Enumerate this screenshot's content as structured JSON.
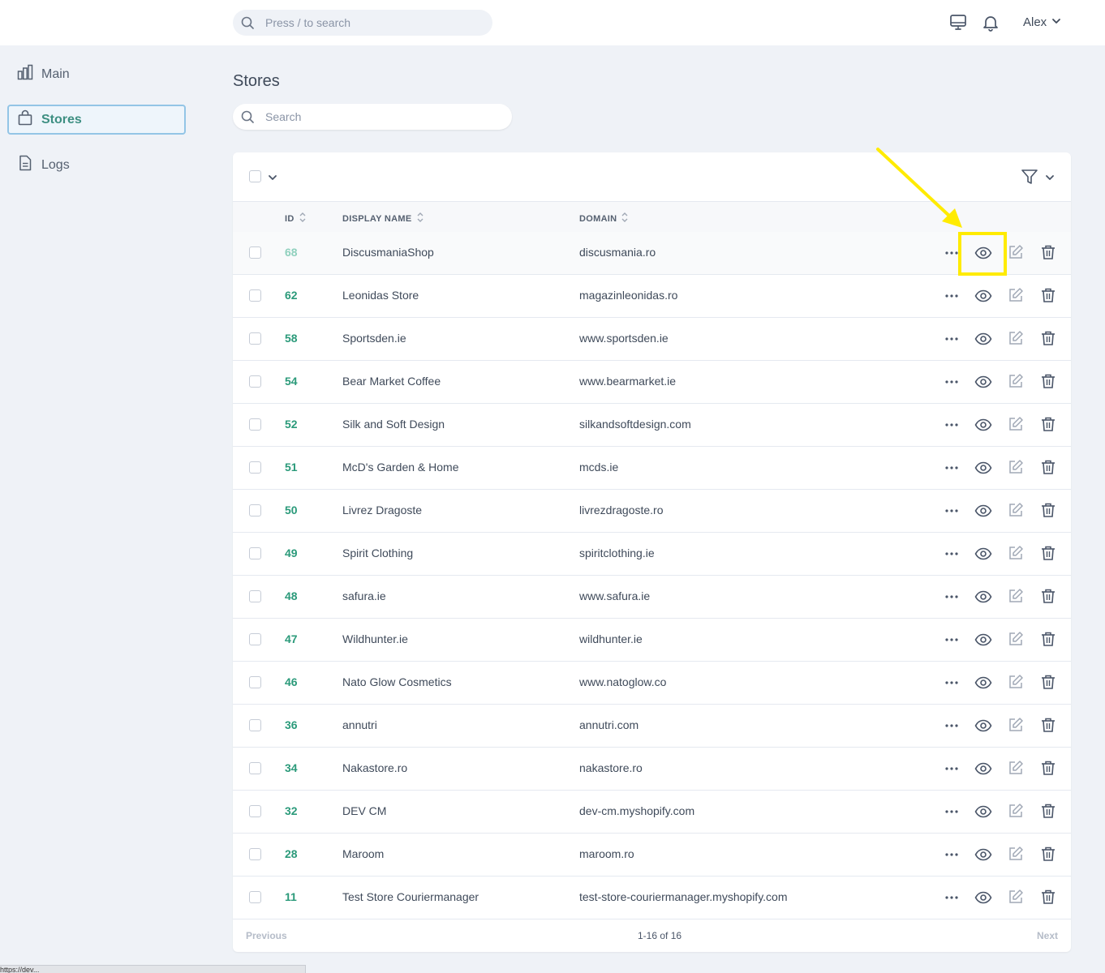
{
  "topbar": {
    "search_placeholder": "Press / to search",
    "user_name": "Alex"
  },
  "sidebar": {
    "items": [
      {
        "label": "Main"
      },
      {
        "label": "Stores"
      },
      {
        "label": "Logs"
      }
    ]
  },
  "page": {
    "title": "Stores",
    "search_placeholder": "Search"
  },
  "table": {
    "columns": {
      "id": "ID",
      "name": "DISPLAY NAME",
      "domain": "DOMAIN"
    },
    "rows": [
      {
        "id": "68",
        "name": "DiscusmaniaShop",
        "domain": "discusmania.ro"
      },
      {
        "id": "62",
        "name": "Leonidas Store",
        "domain": "magazinleonidas.ro"
      },
      {
        "id": "58",
        "name": "Sportsden.ie",
        "domain": "www.sportsden.ie"
      },
      {
        "id": "54",
        "name": "Bear Market Coffee",
        "domain": "www.bearmarket.ie"
      },
      {
        "id": "52",
        "name": "Silk and Soft Design",
        "domain": "silkandsoftdesign.com"
      },
      {
        "id": "51",
        "name": "McD's Garden & Home",
        "domain": "mcds.ie"
      },
      {
        "id": "50",
        "name": "Livrez Dragoste",
        "domain": "livrezdragoste.ro"
      },
      {
        "id": "49",
        "name": "Spirit Clothing",
        "domain": "spiritclothing.ie"
      },
      {
        "id": "48",
        "name": "safura.ie",
        "domain": "www.safura.ie"
      },
      {
        "id": "47",
        "name": "Wildhunter.ie",
        "domain": "wildhunter.ie"
      },
      {
        "id": "46",
        "name": "Nato Glow Cosmetics",
        "domain": "www.natoglow.co"
      },
      {
        "id": "36",
        "name": "annutri",
        "domain": "annutri.com"
      },
      {
        "id": "34",
        "name": "Nakastore.ro",
        "domain": "nakastore.ro"
      },
      {
        "id": "32",
        "name": "DEV CM",
        "domain": "dev-cm.myshopify.com"
      },
      {
        "id": "28",
        "name": "Maroom",
        "domain": "maroom.ro"
      },
      {
        "id": "11",
        "name": "Test Store Couriermanager",
        "domain": "test-store-couriermanager.myshopify.com"
      }
    ]
  },
  "pagination": {
    "previous": "Previous",
    "range": "1-16 of 16",
    "next": "Next"
  },
  "statusbar": {
    "url": "https://dev..."
  },
  "icons": {
    "sidebar": [
      "bar-chart-icon",
      "shopping-bag-icon",
      "document-icon"
    ],
    "topbar": [
      "search-icon",
      "monitor-icon",
      "bell-icon",
      "chevron-down-icon"
    ],
    "row_actions": [
      "more-icon",
      "eye-icon",
      "edit-icon",
      "trash-icon"
    ]
  },
  "colors": {
    "accent_green": "#2b9a7a",
    "highlight_yellow": "#ffeb00",
    "active_border": "#93c5e6"
  }
}
